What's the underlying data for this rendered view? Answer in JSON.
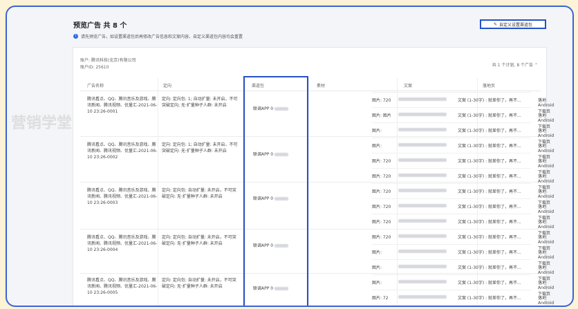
{
  "header": {
    "title": "预览广告 共 8 个",
    "notice": "请先预览广告，如设置渠道包后再修改广告信息和文案内容，自定义渠道包内容均会重置",
    "custom_button": "自定义设置渠道包"
  },
  "account": {
    "name": "账户: 腾讯科技(北京)有限公司",
    "id": "账户ID: 25610",
    "summary": "共 1 个计划, 8 个广告"
  },
  "columns": [
    "广告名称",
    "定向",
    "渠道包",
    "素材",
    "文案",
    "落地页"
  ],
  "rows": [
    {
      "name": "腾讯看点、QQ、腾讯音乐及游戏、腾讯新闻、腾讯视频、优量汇-2021-06-10 23:26-0001",
      "targeting": "定向: 定向包:  1; 自动扩量: 未开启，不可突破定向; 无·扩量种子人群: 未开启",
      "channel": "联调APP 0"
    },
    {
      "name": "腾讯看点、QQ、腾讯音乐及游戏、腾讯新闻、腾讯视频、优量汇-2021-06-10 23:26-0002",
      "targeting": "定向: 定向包:  1; 自动扩量: 未开启，不可突破定向: 无·扩量种子人群: 未开启",
      "channel": "联调APP 0"
    },
    {
      "name": "腾讯看点、QQ、腾讯音乐及游戏、腾讯新闻、腾讯视频、优量汇-2021-06-10 23:26-0003",
      "targeting": "定向: 定向包:  自动扩量: 未开启，不可突破定向: 无·扩量种子人群: 未开启",
      "channel": "联调APP 0"
    },
    {
      "name": "腾讯看点、QQ、腾讯音乐及游戏、腾讯新闻、腾讯视频、优量汇-2021-06-10 23:26-0004",
      "targeting": "定向: 定向包:  自动扩量: 未开启，不可突破定向: 无·扩量种子人群: 未开启",
      "channel": "联调APP 0"
    },
    {
      "name": "腾讯看点、QQ、腾讯音乐及游戏、腾讯新闻、腾讯视频、优量汇-2021-06-10 23:26-0005",
      "targeting": "定向: 定向包:  自动扩量: 未开启，不可突破定向: 无·扩量种子人群: 未开启",
      "channel": "联调APP 0"
    }
  ],
  "materials": [
    {
      "img": "图片: 720",
      "copy": "文案 (1-30字) : 就差你了，再不...",
      "landing": "落地Android下载页"
    },
    {
      "img": "图片: 图片",
      "copy": "文案 (1-30字) : 就差你了，再不...",
      "landing": "落地Android下载页"
    },
    {
      "img": "图片:",
      "copy": "文案 (1-30字) : 就差你了，再不...",
      "landing": "落地Android下载页"
    },
    {
      "img": "图片:",
      "copy": "文案 (1-30字) : 就差你了，再不...",
      "landing": "落地Android下载页"
    },
    {
      "img": "图片: 720",
      "copy": "文案 (1-30字) : 就差你了，再不...",
      "landing": "落地Android下载页"
    },
    {
      "img": "图片: 720",
      "copy": "文案 (1-30字) : 就差你了，再不...",
      "landing": "落地Android下载页"
    },
    {
      "img": "图片: 720",
      "copy": "文案 (1-30字) : 就差你了，再不...",
      "landing": "落地Android下载页"
    },
    {
      "img": "图片: 720",
      "copy": "文案 (1-30字) : 就差你了，再不...",
      "landing": "落地Android下载页"
    },
    {
      "img": "图片: 720",
      "copy": "文案 (1-30字) : 就差你了，再不...",
      "landing": "落地Android下载页"
    },
    {
      "img": "图片: 720",
      "copy": "文案 (1-30字) : 就差你了，再不...",
      "landing": "落地Android下载页"
    },
    {
      "img": "图片:",
      "copy": "文案 (1-30字) : 就差你了，再不...",
      "landing": "落地Android下载页"
    },
    {
      "img": "图片:",
      "copy": "文案 (1-30字) : 就差你了，再不...",
      "landing": "落地Android下载页"
    },
    {
      "img": "图片:",
      "copy": "文案 (1-30字) : 就差你了，再不...",
      "landing": "落地Android下载页"
    },
    {
      "img": "图片: 72",
      "copy": "文案 (1-30字) : 就差你了，再不...",
      "landing": "落地Android下载页"
    }
  ],
  "watermark": "营销学堂"
}
